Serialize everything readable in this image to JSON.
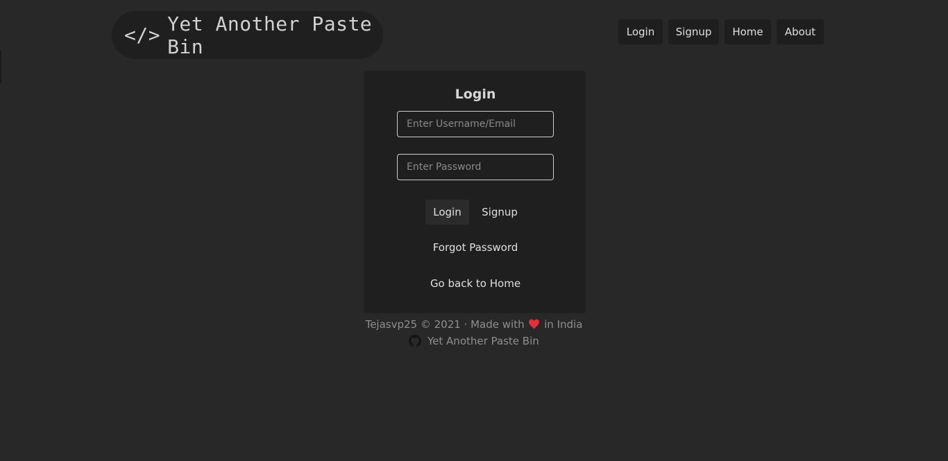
{
  "brand": {
    "logo_symbol": "</>",
    "title": "Yet Another Paste Bin"
  },
  "nav": {
    "login": "Login",
    "signup": "Signup",
    "home": "Home",
    "about": "About"
  },
  "login_card": {
    "title": "Login",
    "username_placeholder": "Enter Username/Email",
    "password_placeholder": "Enter Password",
    "login_button": "Login",
    "signup_button": "Signup",
    "forgot_password": "Forgot Password",
    "back_home": "Go back to Home"
  },
  "footer": {
    "copyright_prefix": "Tejasvp25 © 2021 · Made with",
    "copyright_suffix": "in India",
    "repo_link": "Yet Another Paste Bin"
  },
  "icons": {
    "heart": "heart-icon",
    "github": "github-icon"
  },
  "colors": {
    "background": "#282828",
    "card": "#1f1f1f",
    "heart": "#e0303c"
  }
}
